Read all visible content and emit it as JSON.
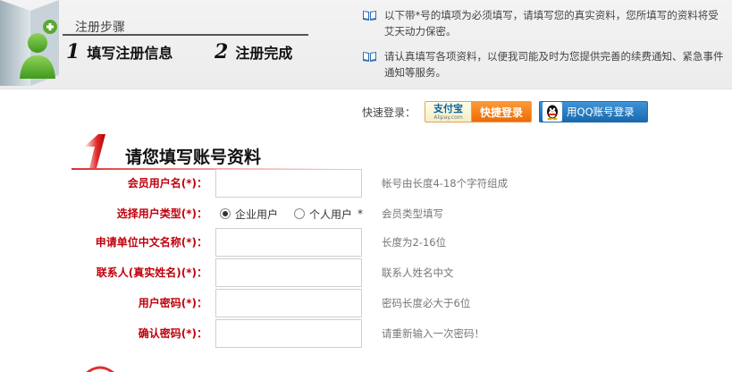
{
  "header": {
    "steps_title": "注册步骤",
    "step1_number": "1",
    "step1_label": "填写注册信息",
    "step2_number": "2",
    "step2_label": "注册完成"
  },
  "notes": [
    "以下带*号的填项为必须填写，请填写您的真实资料，您所填写的资料将受艾天动力保密。",
    "请认真填写各项资料，以便我司能及时为您提供完善的续费通知、紧急事件通知等服务。"
  ],
  "quick_login": {
    "label": "快速登录：",
    "alipay_brand": "支付宝",
    "alipay_domain": "Alipay.com",
    "alipay_action": "快捷登录",
    "qq_label": "用QQ账号登录"
  },
  "section": {
    "number": "1",
    "title": "请您填写账号资料"
  },
  "form": {
    "username": {
      "label": "会员用户名(*)：",
      "value": "",
      "hint": "帐号由长度4-18个字符组成"
    },
    "user_type": {
      "label": "选择用户类型(*)：",
      "options": [
        "企业用户",
        "个人用户"
      ],
      "selected": "企业用户",
      "star": "*",
      "hint": "会员类型填写"
    },
    "company": {
      "label": "申请单位中文名称(*)：",
      "value": "",
      "hint": "长度为2-16位"
    },
    "contact": {
      "label": "联系人(真实姓名)(*)：",
      "value": "",
      "hint": "联系人姓名中文"
    },
    "password": {
      "label": "用户密码(*)：",
      "value": "",
      "hint": "密码长度必大于6位"
    },
    "confirm": {
      "label": "确认密码(*)：",
      "value": "",
      "hint": "请重新输入一次密码！"
    }
  },
  "colors": {
    "label_red": "#c0000c",
    "alipay_orange": "#ee6a07",
    "qq_blue": "#1a69ad"
  },
  "icons": [
    "user-add-icon",
    "book-icon",
    "qq-penguin-icon"
  ]
}
